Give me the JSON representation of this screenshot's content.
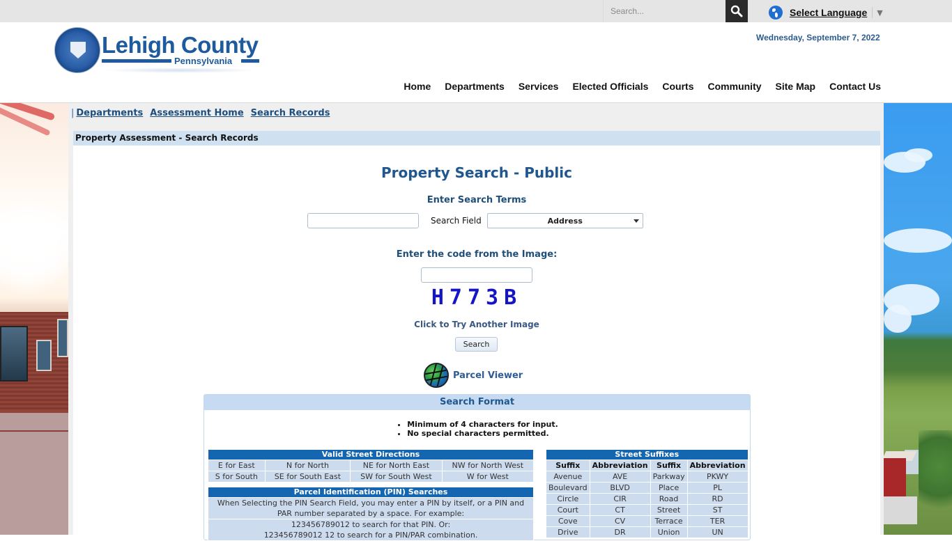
{
  "topbar": {
    "search_placeholder": "Search...",
    "search_icon": "magnifier-icon",
    "language_label": "Select Language",
    "language_arrow": "▼"
  },
  "header": {
    "logo_title": "Lehigh County",
    "logo_subtitle": "Pennsylvania",
    "date": "Wednesday, September 7, 2022",
    "nav": [
      "Home",
      "Departments",
      "Services",
      "Elected Officials",
      "Courts",
      "Community",
      "Site Map",
      "Contact Us"
    ]
  },
  "breadcrumb": {
    "separator": "|",
    "items": [
      "Departments",
      "Assessment Home",
      "Search Records"
    ]
  },
  "panel": {
    "title": "Property Assessment - Search Records"
  },
  "search": {
    "heading": "Property Search - Public",
    "terms_label": "Enter Search Terms",
    "terms_value": "",
    "field_label": "Search Field",
    "field_selected": "Address",
    "captcha_label": "Enter the code from the Image:",
    "captcha_value": "",
    "captcha_code": "H773B",
    "try_another": "Click to Try Another Image",
    "search_button": "Search",
    "parcel_viewer": "Parcel Viewer"
  },
  "format": {
    "title": "Search Format",
    "rules": [
      "Minimum of 4 characters for input.",
      "No special characters permitted."
    ],
    "directions": {
      "title": "Valid Street Directions",
      "rows": [
        [
          "E for East",
          "N for North",
          "NE for North East",
          "NW for North West"
        ],
        [
          "S for South",
          "SE for South East",
          "SW for South West",
          "W for West"
        ]
      ]
    },
    "pin": {
      "title": "Parcel Identification (PIN) Searches",
      "text1": "When Selecting the PIN Search Field, you may enter a PIN by itself, or a PIN and PAR number separated by a space. For example:",
      "text2": "123456789012 to search for that PIN. Or:",
      "text3": "123456789012 12 to search for a PIN/PAR combination."
    },
    "suffixes": {
      "title": "Street Suffixes",
      "headers": [
        "Suffix",
        "Abbreviation",
        "Suffix",
        "Abbreviation"
      ],
      "rows": [
        [
          "Avenue",
          "AVE",
          "Parkway",
          "PKWY"
        ],
        [
          "Boulevard",
          "BLVD",
          "Place",
          "PL"
        ],
        [
          "Circle",
          "CIR",
          "Road",
          "RD"
        ],
        [
          "Court",
          "CT",
          "Street",
          "ST"
        ],
        [
          "Cove",
          "CV",
          "Terrace",
          "TER"
        ],
        [
          "Drive",
          "DR",
          "Union",
          "UN"
        ]
      ]
    }
  },
  "colors": {
    "brand_blue": "#1d5a9e",
    "table_header": "#1566b0",
    "table_cell": "#ccdbee",
    "panel_title_bg": "#cfe0f0"
  }
}
